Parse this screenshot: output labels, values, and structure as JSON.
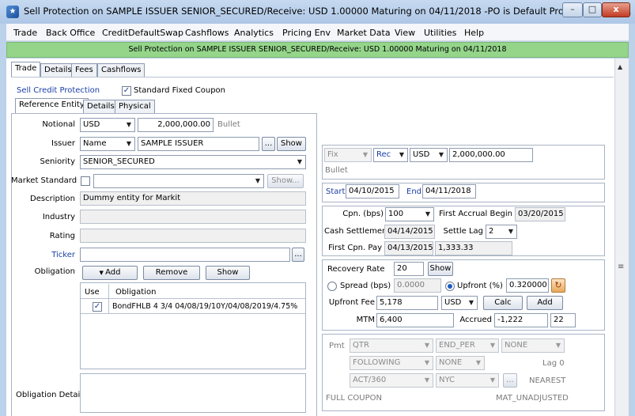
{
  "window": {
    "title": "Sell Protection on SAMPLE ISSUER SENIOR_SECURED/Receive: USD 1.00000 Maturing on 04/11/2018  -PO is Default Processing Orga...",
    "min": "–",
    "max": "□",
    "close": "x"
  },
  "menu": [
    "Trade",
    "Back Office",
    "CreditDefaultSwap",
    "Cashflows",
    "Analytics",
    "Pricing Env",
    "Market Data",
    "View",
    "Utilities",
    "Help"
  ],
  "banner": "Sell Protection on SAMPLE ISSUER SENIOR_SECURED/Receive: USD 1.00000 Maturing on 04/11/2018",
  "tabs_main": [
    "Trade",
    "Details",
    "Fees",
    "Cashflows"
  ],
  "trade": {
    "type_link": "Sell Credit Protection",
    "std_fixed_coupon_label": "Standard Fixed Coupon",
    "std_fixed_coupon_checked": "✓"
  },
  "ref_tabs": [
    "Reference Entity",
    "Details",
    "Physical"
  ],
  "ref": {
    "notional_label": "Notional",
    "notional_ccy": "USD",
    "notional_value": "2,000,000.00",
    "notional_type": "Bullet",
    "issuer_label": "Issuer",
    "issuer_type": "Name",
    "issuer_value": "SAMPLE ISSUER",
    "issuer_ellipsis": "...",
    "issuer_show": "Show",
    "seniority_label": "Seniority",
    "seniority_value": "SENIOR_SECURED",
    "market_standard_label": "Market Standard",
    "market_standard_show": "Show...",
    "description_label": "Description",
    "description_value": "Dummy entity for Markit",
    "industry_label": "Industry",
    "rating_label": "Rating",
    "ticker_label": "Ticker",
    "ticker_ellipsis": "...",
    "obligation_label": "Obligation",
    "add_label": "Add",
    "remove_label": "Remove",
    "show_label": "Show",
    "ob_table": {
      "headers": [
        "Use",
        "Obligation"
      ],
      "rows": [
        {
          "use": "✓",
          "obligation": "BondFHLB 4 3/4 04/08/19/10Y/04/08/2019/4.75%"
        }
      ]
    },
    "obligation_detail_label": "Obligation Detail"
  },
  "leg": {
    "fix": "Fix",
    "rec": "Rec",
    "ccy": "USD",
    "amount": "2,000,000.00",
    "bullet": "Bullet"
  },
  "dates": {
    "start_label": "Start",
    "start_value": "04/10/2015",
    "end_label": "End",
    "end_value": "04/11/2018"
  },
  "coupon": {
    "cpn_label": "Cpn. (bps)",
    "cpn_value": "100",
    "first_accrual_label": "First Accrual Begin",
    "first_accrual_value": "03/20/2015",
    "cash_settle_label": "Cash Settlement",
    "cash_settle_value": "04/14/2015",
    "settle_lag_label": "Settle Lag",
    "settle_lag_value": "2",
    "first_cpn_label": "First Cpn. Pay",
    "first_cpn_date": "04/13/2015",
    "first_cpn_amt": "1,333.33"
  },
  "recovery": {
    "rate_label": "Recovery Rate",
    "rate_value": "20",
    "show_label": "Show",
    "spread_label": "Spread (bps)",
    "spread_value": "0.0000",
    "upfront_pct_label": "Upfront (%)",
    "upfront_pct_value": "0.320000",
    "upfront_fee_label": "Upfront Fee",
    "upfront_fee_value": "5,178",
    "fee_ccy": "USD",
    "calc_label": "Calc",
    "add_label": "Add",
    "mtm_label": "MTM",
    "mtm_value": "6,400",
    "accrued_label": "Accrued",
    "accrued_value": "-1,222",
    "accrued_days": "22"
  },
  "payment": {
    "pmt_label": "Pmt",
    "freq": "QTR",
    "period": "END_PER",
    "stub": "NONE",
    "roll": "FOLLOWING",
    "adj": "NONE",
    "lag": "Lag 0",
    "daycount": "ACT/360",
    "calendar": "NYC",
    "ellipsis": "...",
    "rounding": "NEAREST",
    "coupon_type": "FULL COUPON",
    "adjust": "MAT_UNADJUSTED"
  },
  "colors": {
    "banner": "#94d58a",
    "link": "#1a3fa8"
  }
}
